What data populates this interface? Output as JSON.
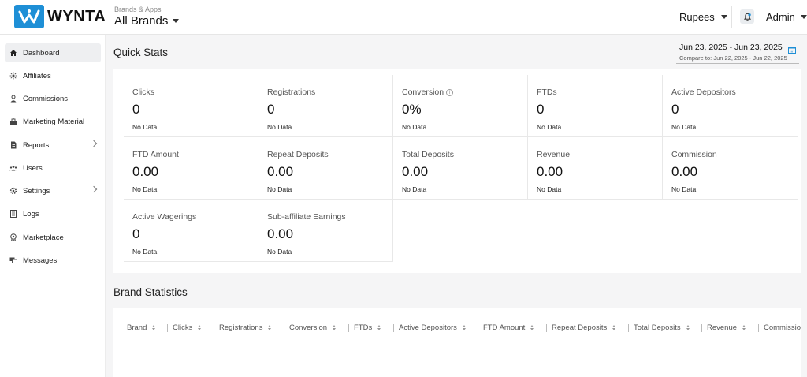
{
  "header": {
    "logo_text": "WYNTA",
    "brand_context_small": "Brands & Apps",
    "brand_context_value": "All Brands",
    "currency": "Rupees",
    "user": "Admin"
  },
  "sidebar": {
    "items": [
      {
        "label": "Dashboard",
        "icon": "home-icon"
      },
      {
        "label": "Affiliates",
        "icon": "affiliates-icon"
      },
      {
        "label": "Commissions",
        "icon": "commissions-icon"
      },
      {
        "label": "Marketing Material",
        "icon": "marketing-icon"
      },
      {
        "label": "Reports",
        "icon": "reports-icon"
      },
      {
        "label": "Users",
        "icon": "users-icon"
      },
      {
        "label": "Settings",
        "icon": "gear-icon"
      },
      {
        "label": "Logs",
        "icon": "logs-icon"
      },
      {
        "label": "Marketplace",
        "icon": "marketplace-icon"
      },
      {
        "label": "Messages",
        "icon": "messages-icon"
      }
    ]
  },
  "quick_stats": {
    "title": "Quick Stats",
    "date_range": "Jun 23, 2025 - Jun 23, 2025",
    "compare_to": "Compare to: Jun 22, 2025 - Jun 22, 2025",
    "cards": [
      {
        "label": "Clicks",
        "value": "0",
        "sub": "No Data"
      },
      {
        "label": "Registrations",
        "value": "0",
        "sub": "No Data"
      },
      {
        "label": "Conversion",
        "value": "0%",
        "sub": "No Data",
        "info": "i"
      },
      {
        "label": "FTDs",
        "value": "0",
        "sub": "No Data"
      },
      {
        "label": "Active Depositors",
        "value": "0",
        "sub": "No Data"
      },
      {
        "label": "FTD Amount",
        "value": "0.00",
        "sub": "No Data"
      },
      {
        "label": "Repeat Deposits",
        "value": "0.00",
        "sub": "No Data"
      },
      {
        "label": "Total Deposits",
        "value": "0.00",
        "sub": "No Data"
      },
      {
        "label": "Revenue",
        "value": "0.00",
        "sub": "No Data"
      },
      {
        "label": "Commission",
        "value": "0.00",
        "sub": "No Data"
      },
      {
        "label": "Active Wagerings",
        "value": "0",
        "sub": "No Data"
      },
      {
        "label": "Sub-affiliate Earnings",
        "value": "0.00",
        "sub": "No Data"
      }
    ]
  },
  "brand_statistics": {
    "title": "Brand Statistics",
    "columns": [
      "Brand",
      "Clicks",
      "Registrations",
      "Conversion",
      "FTDs",
      "Active Depositors",
      "FTD Amount",
      "Repeat Deposits",
      "Total Deposits",
      "Revenue",
      "Commissio"
    ]
  },
  "colors": {
    "brand_blue": "#1e8fd6",
    "background": "#f5f5f6",
    "active_nav": "#eeeff1"
  }
}
